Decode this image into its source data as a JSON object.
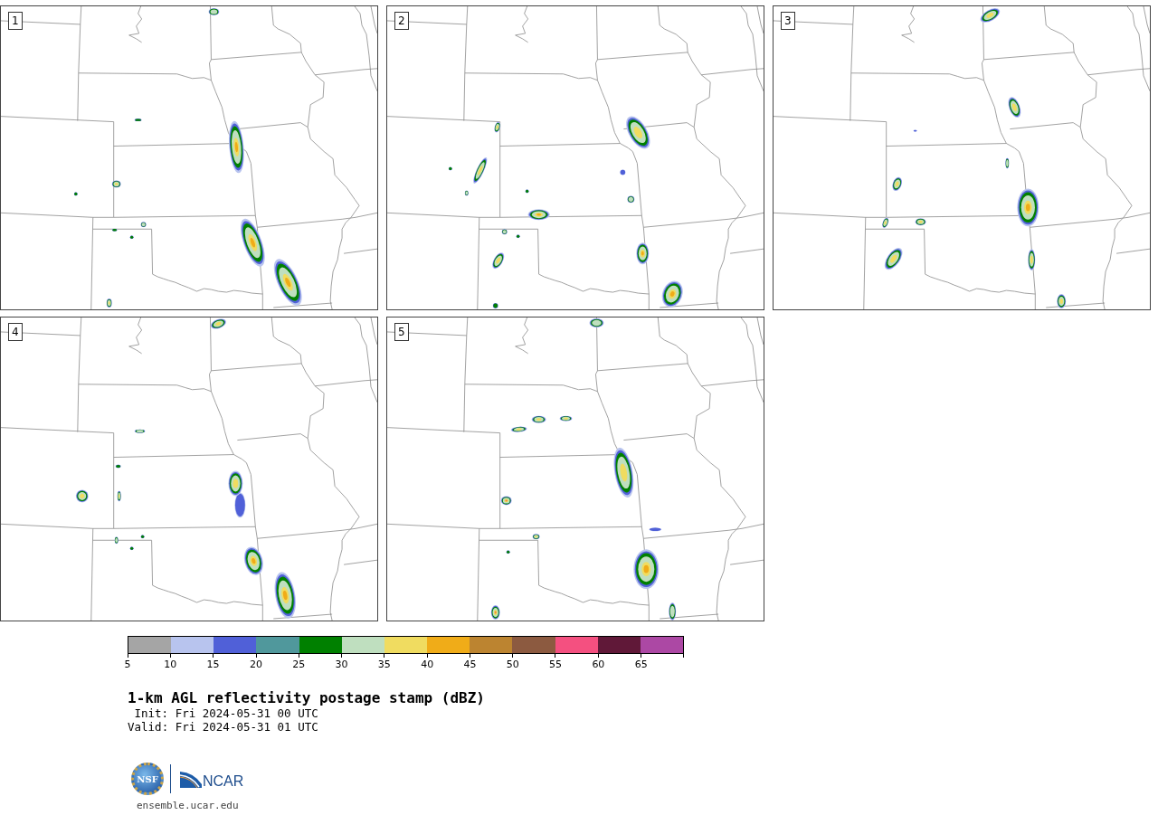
{
  "panels": [
    {
      "label": "1"
    },
    {
      "label": "2"
    },
    {
      "label": "3"
    },
    {
      "label": "4"
    },
    {
      "label": "5"
    }
  ],
  "colorbar": {
    "segments": [
      {
        "color": "#a5a5a5"
      },
      {
        "color": "#b8c4ee"
      },
      {
        "color": "#5060d8"
      },
      {
        "color": "#50989c"
      },
      {
        "color": "#008000"
      },
      {
        "color": "#bfdfbf"
      },
      {
        "color": "#f0dc60"
      },
      {
        "color": "#f0ac18"
      },
      {
        "color": "#bc8430"
      },
      {
        "color": "#8c5a40"
      },
      {
        "color": "#f45080"
      },
      {
        "color": "#601838"
      },
      {
        "color": "#ac48a4"
      }
    ],
    "ticks": [
      "5",
      "10",
      "15",
      "20",
      "25",
      "30",
      "35",
      "40",
      "45",
      "50",
      "55",
      "60",
      "65"
    ]
  },
  "title": "1-km AGL reflectivity postage stamp (dBZ)",
  "init": "Init: Fri 2024-05-31 00 UTC",
  "valid": "Valid: Fri 2024-05-31 01 UTC",
  "logos": {
    "nsf": "NSF",
    "ncar": "NCAR"
  },
  "website": "ensemble.ucar.edu"
}
